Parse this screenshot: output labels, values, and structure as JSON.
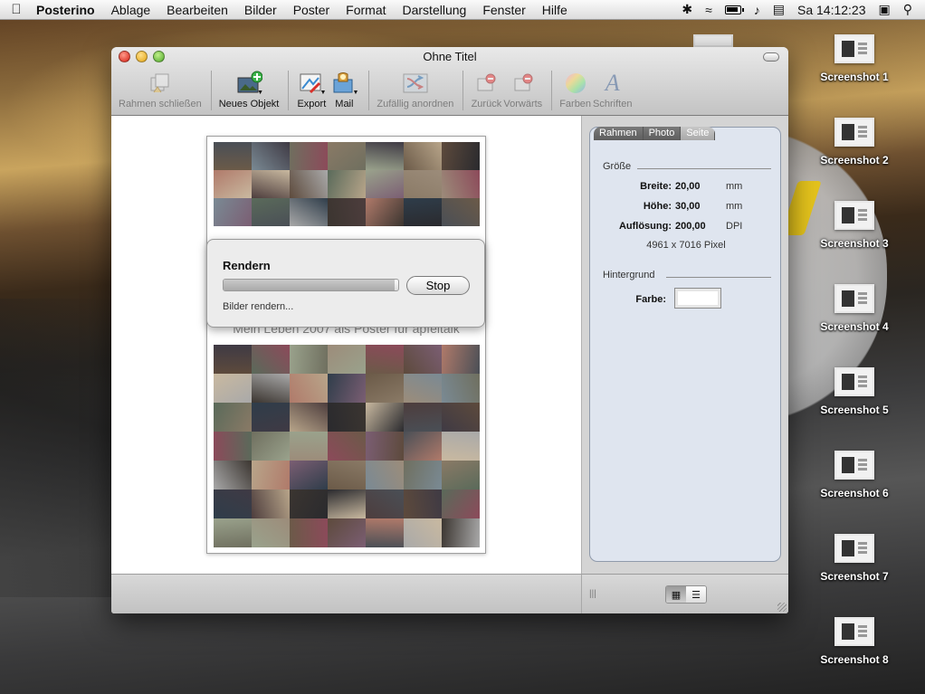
{
  "menubar": {
    "app": "Posterino",
    "items": [
      "Ablage",
      "Bearbeiten",
      "Bilder",
      "Poster",
      "Format",
      "Darstellung",
      "Fenster",
      "Hilfe"
    ],
    "clock": "Sa 14:12:23"
  },
  "window": {
    "title": "Ohne Titel",
    "toolbar": {
      "close_frame": "Rahmen schließen",
      "new_object": "Neues Objekt",
      "export": "Export",
      "mail": "Mail",
      "shuffle": "Zufällig anordnen",
      "back": "Zurück",
      "forward": "Vorwärts",
      "colors": "Farben",
      "fonts": "Schriften"
    },
    "poster_caption": "Mein Leben 2007 als Poster für apfeltalk",
    "render": {
      "title": "Rendern",
      "stop": "Stop",
      "status": "Bilder rendern...",
      "progress": 0.98
    }
  },
  "inspector": {
    "tabs": [
      "Rahmen",
      "Photo",
      "Seite"
    ],
    "active_tab": 2,
    "size_section": "Größe",
    "width_label": "Breite:",
    "width_value": "20,00",
    "width_unit": "mm",
    "height_label": "Höhe:",
    "height_value": "30,00",
    "height_unit": "mm",
    "resolution_label": "Auflösung:",
    "resolution_value": "200,00",
    "resolution_unit": "DPI",
    "pixel_size": "4961 x 7016 Pixel",
    "background_section": "Hintergrund",
    "color_label": "Farbe:"
  },
  "desktop": {
    "icons": [
      "Screenshot 1",
      "Screenshot 2",
      "Screenshot 3",
      "Screenshot 4",
      "Screenshot 5",
      "Screenshot 6",
      "Screenshot 7",
      "Screenshot 8"
    ]
  },
  "colors": {
    "photo_palette": [
      "#3b3530",
      "#6b5a48",
      "#8a7a66",
      "#2a2a2e",
      "#5d4a3c",
      "#9c8c7a",
      "#4a4f56",
      "#b07a6a",
      "#7a8a94",
      "#3f3a44",
      "#c9b9a0",
      "#5a6a5a",
      "#8c4a5a",
      "#a9a9a9",
      "#2f3d4a",
      "#6f6f5f",
      "#b8a58a",
      "#4d3d3d",
      "#9aa28c",
      "#7b5e73"
    ]
  }
}
